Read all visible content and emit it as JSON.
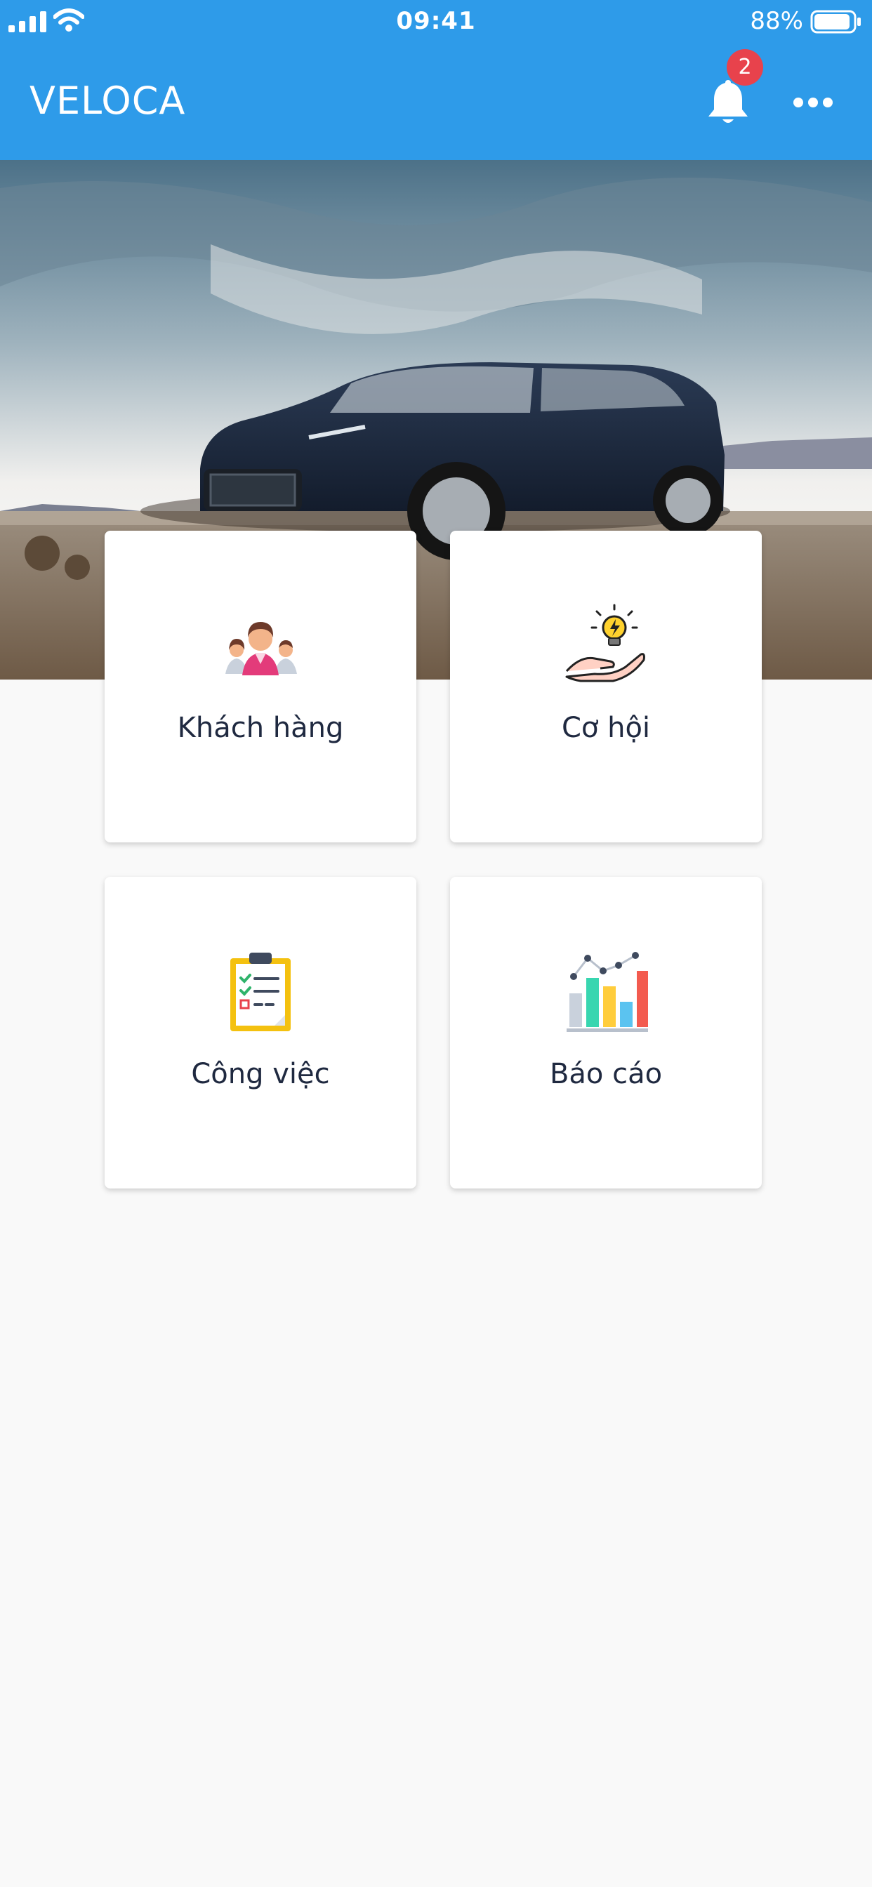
{
  "status_bar": {
    "time": "09:41",
    "battery": "88%"
  },
  "app_bar": {
    "title": "VELOCA",
    "notification_count": "2"
  },
  "menu": [
    {
      "label": "Khách hàng",
      "icon": "customers-icon"
    },
    {
      "label": "Cơ hội",
      "icon": "opportunity-icon"
    },
    {
      "label": "Công việc",
      "icon": "tasks-clipboard-icon"
    },
    {
      "label": "Báo cáo",
      "icon": "report-chart-icon"
    }
  ],
  "colors": {
    "primary": "#2e9be9",
    "badge": "#e8424c",
    "background": "#f9f9f9",
    "text": "#1f2940"
  }
}
